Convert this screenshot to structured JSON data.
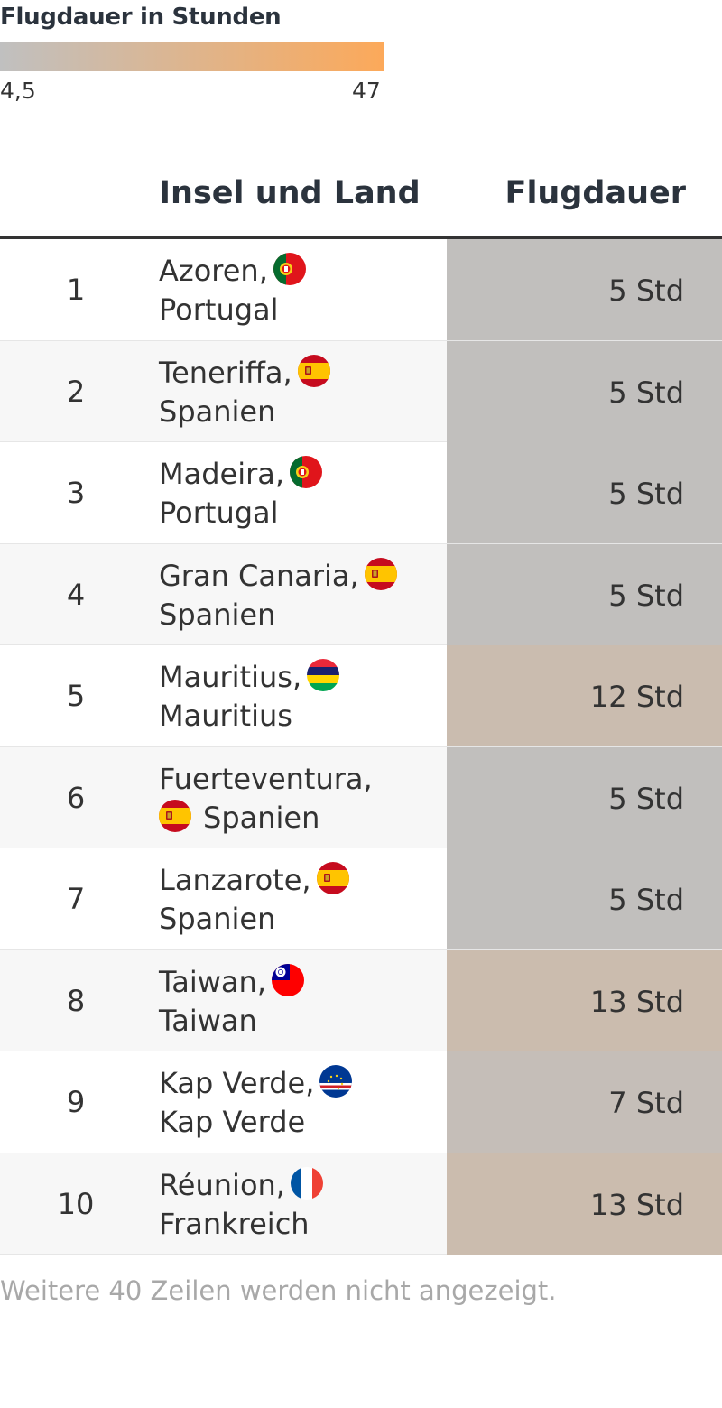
{
  "legend": {
    "title": "Flugdauer in Stunden",
    "min_label": "4,5",
    "max_label": "47",
    "min_value": 4.5,
    "max_value": 47,
    "color_low": "#c0c0c0",
    "color_high": "#fca95a"
  },
  "header": {
    "col_land": "Insel und Land",
    "col_dauer": "Flugdauer"
  },
  "chart_data": {
    "type": "table",
    "columns": [
      "",
      "Insel und Land",
      "Flugdauer"
    ],
    "rows": [
      {
        "rank": "1",
        "island": "Azoren,",
        "country": "Portugal",
        "flag": "portugal-flag-icon",
        "hours": 5,
        "label": "5 Std",
        "flag_inline": true
      },
      {
        "rank": "2",
        "island": "Teneriffa,",
        "country": "Spanien",
        "flag": "spain-flag-icon",
        "hours": 5,
        "label": "5 Std",
        "flag_inline": true
      },
      {
        "rank": "3",
        "island": "Madeira,",
        "country": "Portugal",
        "flag": "portugal-flag-icon",
        "hours": 5,
        "label": "5 Std",
        "flag_inline": true
      },
      {
        "rank": "4",
        "island": "Gran Canaria,",
        "country": "Spanien",
        "flag": "spain-flag-icon",
        "hours": 5,
        "label": "5 Std",
        "flag_inline": true
      },
      {
        "rank": "5",
        "island": "Mauritius,",
        "country": "Mauritius",
        "flag": "mauritius-flag-icon",
        "hours": 12,
        "label": "12 Std",
        "flag_inline": true
      },
      {
        "rank": "6",
        "island": "Fuerteventura,",
        "country": "Spanien",
        "flag": "spain-flag-icon",
        "hours": 5,
        "label": "5 Std",
        "flag_inline": false
      },
      {
        "rank": "7",
        "island": "Lanzarote,",
        "country": "Spanien",
        "flag": "spain-flag-icon",
        "hours": 5,
        "label": "5 Std",
        "flag_inline": true
      },
      {
        "rank": "8",
        "island": "Taiwan,",
        "country": "Taiwan",
        "flag": "taiwan-flag-icon",
        "hours": 13,
        "label": "13 Std",
        "flag_inline": true
      },
      {
        "rank": "9",
        "island": "Kap Verde,",
        "country": "Kap Verde",
        "flag": "cape-verde-flag-icon",
        "hours": 7,
        "label": "7 Std",
        "flag_inline": true
      },
      {
        "rank": "10",
        "island": "Réunion,",
        "country": "Frankreich",
        "flag": "france-flag-icon",
        "hours": 13,
        "label": "13 Std",
        "flag_inline": true
      }
    ]
  },
  "footnote": "Weitere 40 Zeilen werden nicht angezeigt."
}
